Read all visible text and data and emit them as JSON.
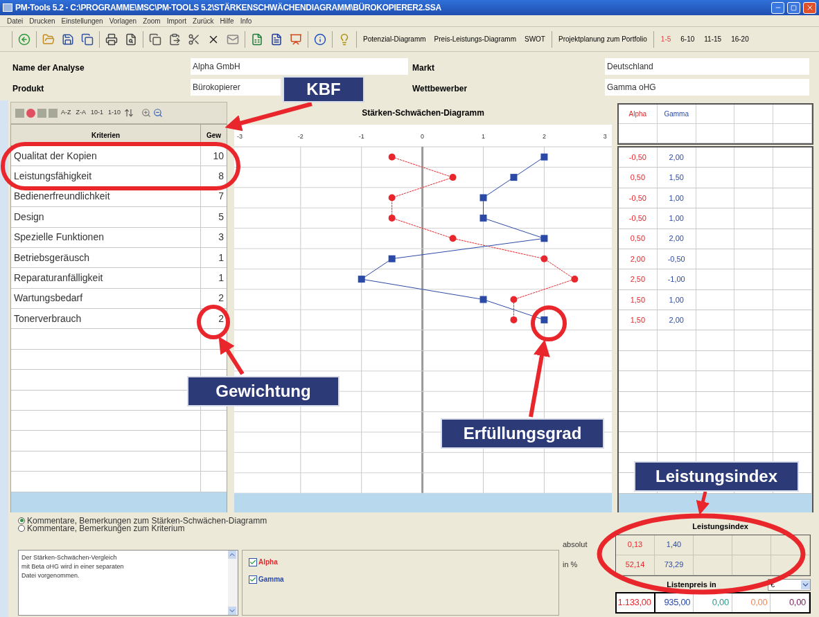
{
  "window": {
    "title": "PM-Tools 5.2 - C:\\PROGRAMME\\MSC\\PM-TOOLS 5.2\\STÄRKENSCHWÄCHENDIAGRAMM\\BÜROKOPIERER2.SSA"
  },
  "menu": [
    "Datei",
    "Drucken",
    "Einstellungen",
    "Vorlagen",
    "Zoom",
    "Import",
    "Zurück",
    "Hilfe",
    "Info"
  ],
  "toolbar": {
    "diagram_buttons": [
      "Potenzial-Diagramm",
      "Preis-Leistungs-Diagramm",
      "SWOT",
      "Projektplanung zum Portfolio"
    ],
    "ranges": [
      {
        "label": "1-5",
        "selected": true
      },
      {
        "label": "6-10",
        "selected": false
      },
      {
        "label": "11-15",
        "selected": false
      },
      {
        "label": "16-20",
        "selected": false
      }
    ]
  },
  "header": {
    "fields": [
      {
        "label": "Name der Analyse",
        "value": "Alpha GmbH"
      },
      {
        "label": "Markt",
        "value": "Deutschland"
      },
      {
        "label": "Produkt",
        "value": "Bürokopierer"
      },
      {
        "label": "Wettbewerber",
        "value": "Gamma oHG"
      }
    ]
  },
  "criteria_panel": {
    "sort_buttons": [
      "A-Z",
      "Z-A",
      "10-1",
      "1-10"
    ],
    "columns": [
      "Kriterien",
      "Gew"
    ],
    "rows": [
      {
        "name": "Qualitat der Kopien",
        "weight": "10"
      },
      {
        "name": "Leistungsfähigkeit",
        "weight": "8"
      },
      {
        "name": "Bedienerfreundlichkeit",
        "weight": "7"
      },
      {
        "name": "Design",
        "weight": "5"
      },
      {
        "name": "Spezielle Funktionen",
        "weight": "3"
      },
      {
        "name": "Betriebsgeräusch",
        "weight": "1"
      },
      {
        "name": "Reparaturanfälligkeit",
        "weight": "1"
      },
      {
        "name": "Wartungsbedarf",
        "weight": "2"
      },
      {
        "name": "Tonerverbrauch",
        "weight": "2"
      }
    ]
  },
  "chart": {
    "title": "Stärken-Schwächen-Diagramm",
    "chart_data": {
      "type": "line",
      "orientation": "horizontal",
      "xlim": [
        -3.09,
        3.11
      ],
      "xticks": [
        -3,
        -2,
        -1,
        0,
        1,
        2,
        3
      ],
      "grid": true,
      "series": [
        {
          "color": "#e8262b",
          "line_style": "dashed",
          "marker": "circle",
          "values": [
            -0.5,
            0.5,
            -0.5,
            -0.5,
            0.5,
            2,
            2.5,
            1.5,
            1.5
          ]
        },
        {
          "color": "#2b4aa8",
          "line_style": "solid",
          "marker": "square",
          "values": [
            2,
            1.5,
            1,
            1,
            2,
            -0.5,
            -1,
            1,
            2
          ]
        }
      ]
    }
  },
  "scores": {
    "columns": [
      "Alpha",
      "Gamma"
    ],
    "rows": [
      [
        "-0,50",
        "2,00"
      ],
      [
        "0,50",
        "1,50"
      ],
      [
        "-0,50",
        "1,00"
      ],
      [
        "-0,50",
        "1,00"
      ],
      [
        "0,50",
        "2,00"
      ],
      [
        "2,00",
        "-0,50"
      ],
      [
        "2,50",
        "-1,00"
      ],
      [
        "1,50",
        "1,00"
      ],
      [
        "1,50",
        "2,00"
      ]
    ]
  },
  "comments": {
    "options": [
      {
        "label": "Kommentare, Bemerkungen zum Stärken-Schwächen-Diagramm",
        "selected": true
      },
      {
        "label": "Kommentare, Bemerkungen zum Kriterium",
        "selected": false
      }
    ],
    "lines": [
      "Der Stärken-Schwächen-Vergleich",
      "mit Beta oHG wird in einer separaten",
      "Datei vorgenommen."
    ]
  },
  "legend": [
    {
      "label": "Alpha",
      "checked": true,
      "color": "#e8262b"
    },
    {
      "label": "Gamma",
      "checked": true,
      "color": "#2b4aa8"
    }
  ],
  "performance_index": {
    "title": "Leistungsindex",
    "rows": [
      {
        "label": "absolut",
        "values": [
          "0,13",
          "1,40"
        ]
      },
      {
        "label": "in %",
        "values": [
          "52,14",
          "73,29"
        ]
      }
    ]
  },
  "list_price": {
    "label": "Listenpreis in",
    "currency": "€",
    "values": [
      {
        "text": "1.133,00",
        "color": "#e8262b"
      },
      {
        "text": "935,00",
        "color": "#2b4aa8"
      },
      {
        "text": "0,00",
        "color": "#2a9a8a"
      },
      {
        "text": "0,00",
        "color": "#f08a5a"
      },
      {
        "text": "0,00",
        "color": "#7a1f5a"
      }
    ]
  },
  "annotations": [
    {
      "text": "KBF"
    },
    {
      "text": "Gewichtung"
    },
    {
      "text": "Erfüllungsgrad"
    },
    {
      "text": "Leistungsindex"
    }
  ]
}
